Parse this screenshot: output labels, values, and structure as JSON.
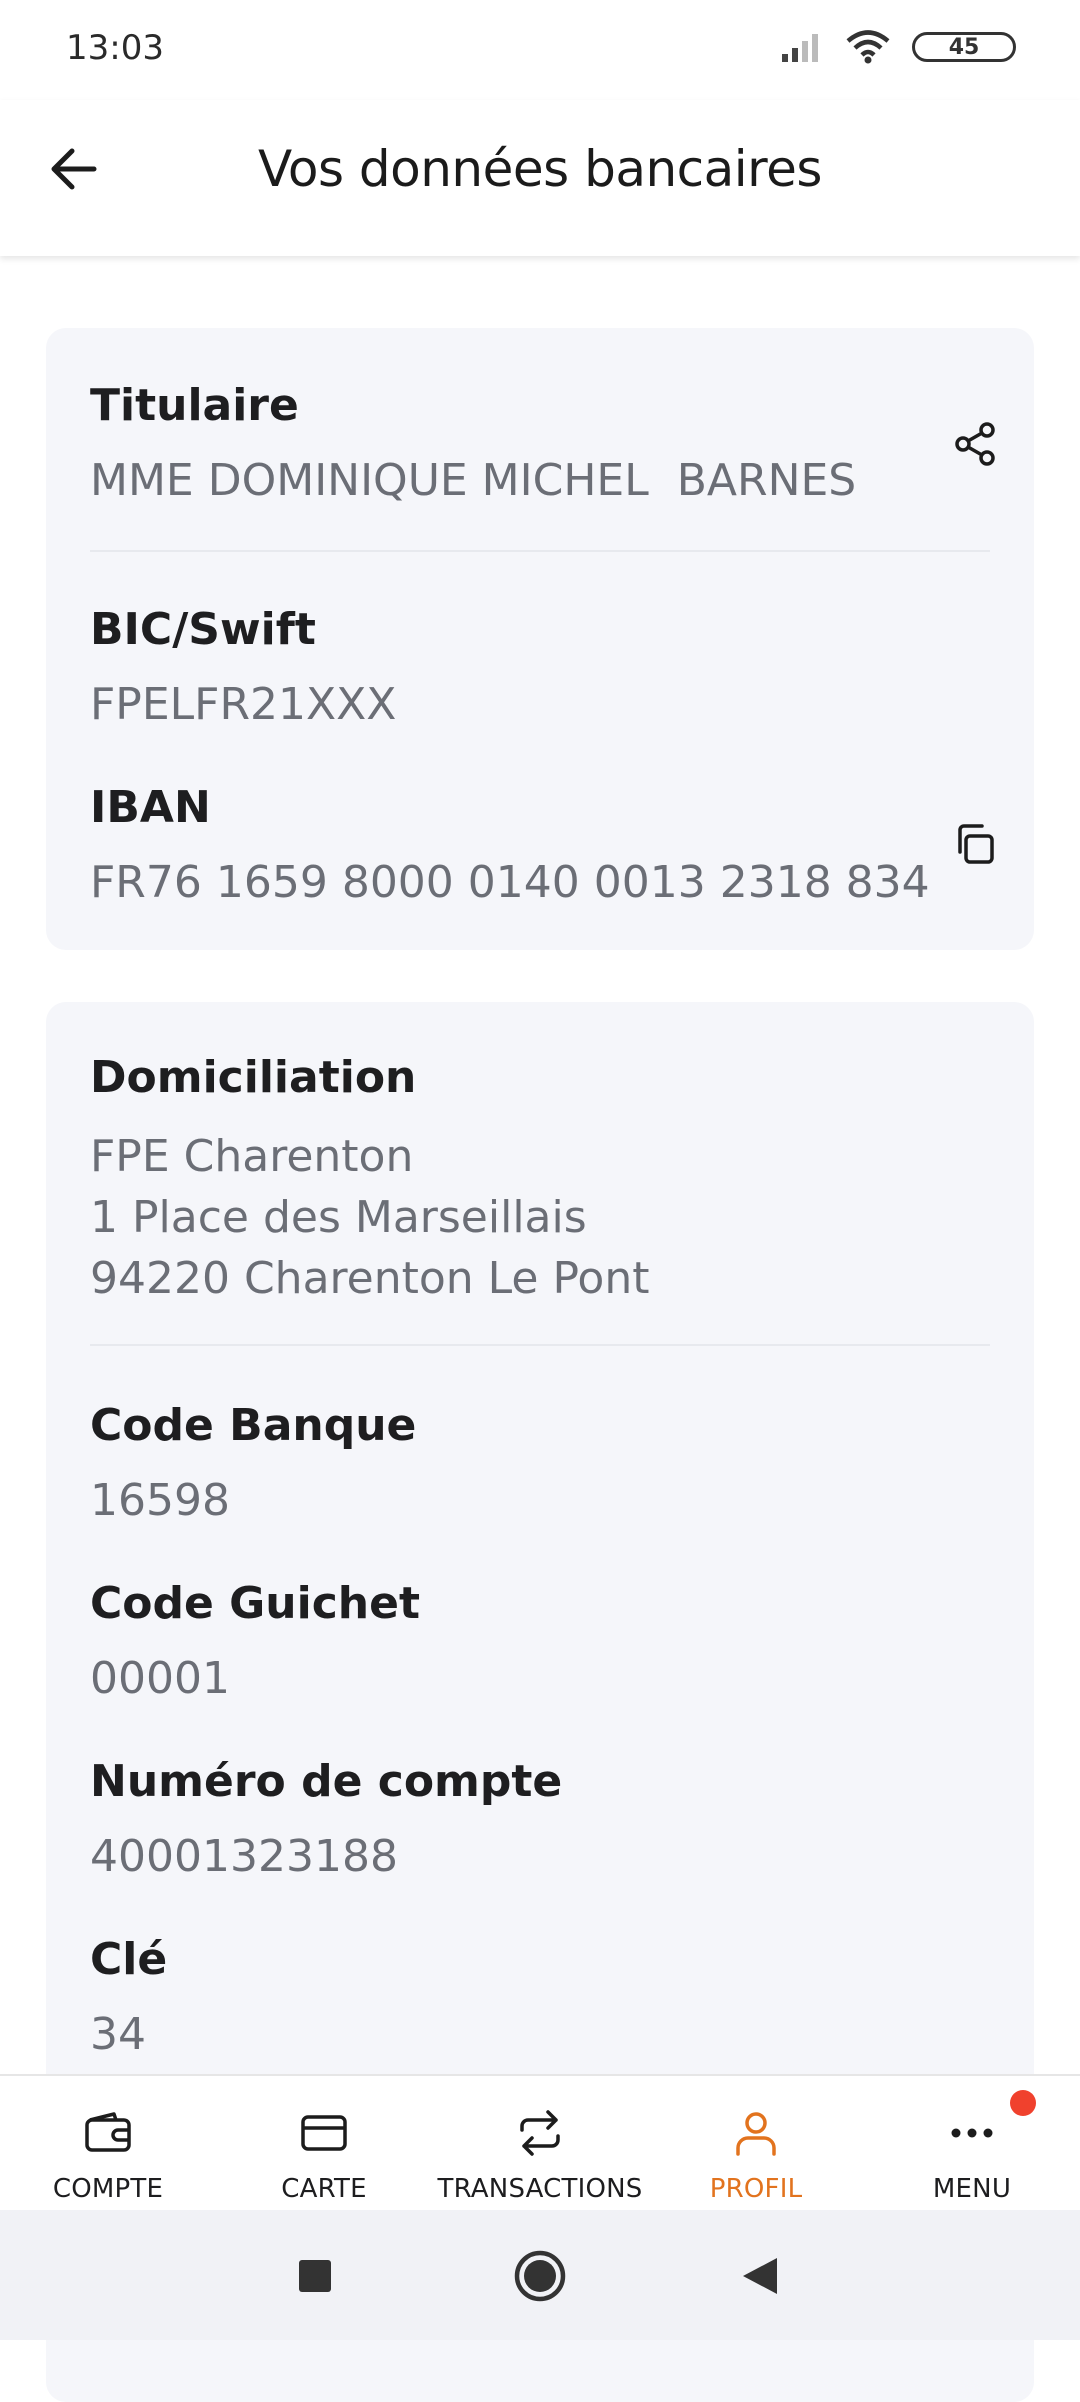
{
  "status_bar": {
    "time": "13:03",
    "battery": "45"
  },
  "header": {
    "title": "Vos données bancaires"
  },
  "card1": {
    "holder": {
      "label": "Titulaire",
      "value": "MME DOMINIQUE MICHEL  BARNES"
    },
    "bic": {
      "label": "BIC/Swift",
      "value": "FPELFR21XXX"
    },
    "iban": {
      "label": "IBAN",
      "value": "FR76 1659 8000 0140 0013 2318 834"
    }
  },
  "card2": {
    "domiciliation": {
      "label": "Domiciliation",
      "value": "FPE Charenton\n1 Place des Marseillais\n94220 Charenton Le Pont"
    },
    "code_banque": {
      "label": "Code Banque",
      "value": "16598"
    },
    "code_guichet": {
      "label": "Code Guichet",
      "value": "00001"
    },
    "numero_compte": {
      "label": "Numéro de compte",
      "value": "40001323188"
    },
    "cle": {
      "label": "Clé",
      "value": "34"
    }
  },
  "bottom_nav": {
    "items": [
      {
        "label": "COMPTE",
        "icon": "wallet-icon"
      },
      {
        "label": "CARTE",
        "icon": "card-icon"
      },
      {
        "label": "TRANSACTIONS",
        "icon": "transfer-icon"
      },
      {
        "label": "PROFIL",
        "icon": "user-icon"
      },
      {
        "label": "MENU",
        "icon": "more-icon"
      }
    ],
    "active_index": 3,
    "active_color": "#e2731e",
    "badge_color": "#f0412d"
  }
}
